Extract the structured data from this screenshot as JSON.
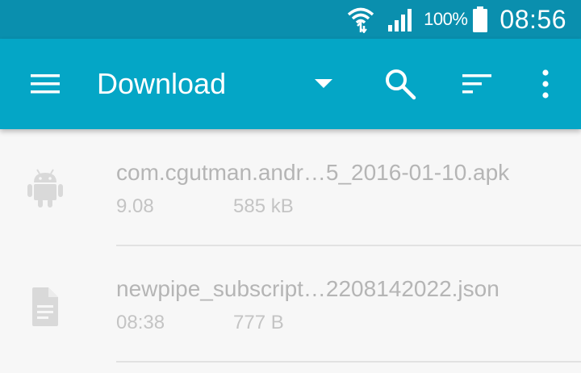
{
  "status_bar": {
    "battery_percent": "100%",
    "time": "08:56",
    "icons": [
      "wifi-icon",
      "signal-icon",
      "battery-icon"
    ]
  },
  "toolbar": {
    "title": "Download",
    "icons": [
      "menu-icon",
      "dropdown-arrow-icon",
      "search-icon",
      "sort-icon",
      "more-vert-icon"
    ]
  },
  "files": [
    {
      "icon": "android-icon",
      "name": "com.cgutman.andr…5_2016-01-10.apk",
      "date": "9.08",
      "size": "585 kB"
    },
    {
      "icon": "document-icon",
      "name": "newpipe_subscript…2208142022.json",
      "date": "08:38",
      "size": "777 B"
    }
  ],
  "colors": {
    "status_bar": "#0a8fae",
    "toolbar": "#04a6c6",
    "background": "#f7f7f7",
    "text_dim": "#b5b5b5"
  }
}
